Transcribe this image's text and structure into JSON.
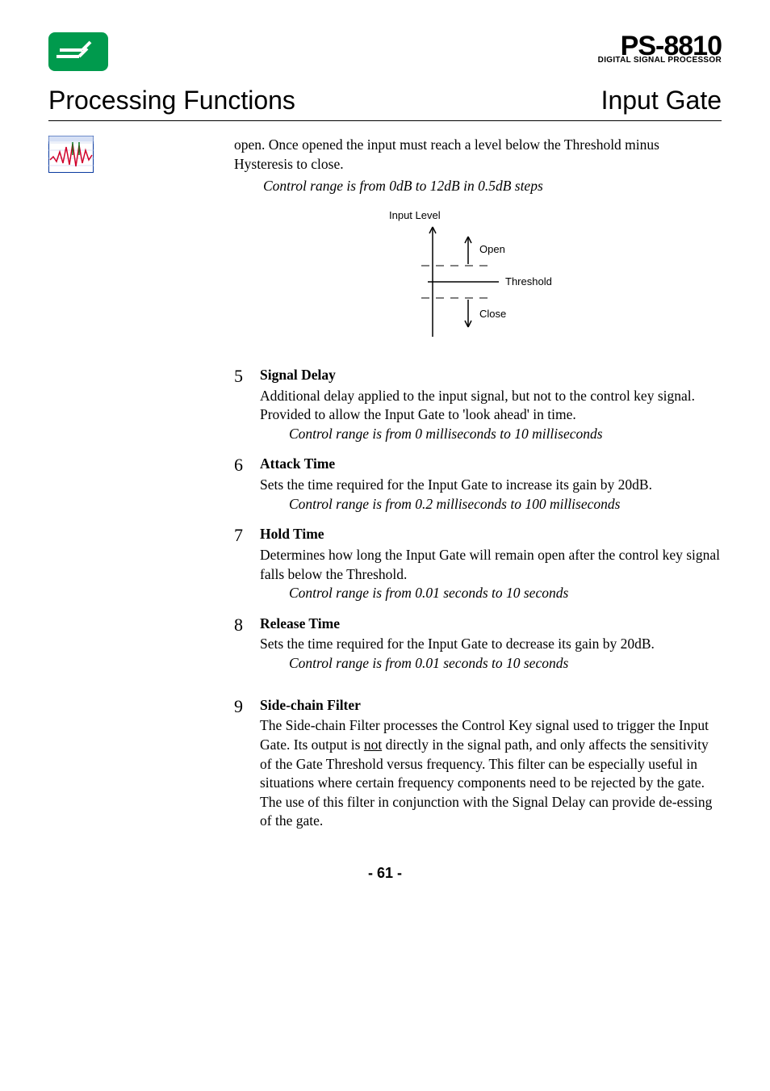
{
  "header": {
    "product_main": "PS-8810",
    "product_sub": "DIGITAL SIGNAL PROCESSOR"
  },
  "title": {
    "left": "Processing Functions",
    "right": "Input Gate"
  },
  "intro": {
    "line1": "open. Once opened the input must reach a level below the Threshold minus Hysteresis to close.",
    "range": "Control range is from 0dB to 12dB in 0.5dB steps"
  },
  "diagram": {
    "caption": "Input Level",
    "label_open": "Open",
    "label_threshold": "Threshold",
    "label_close": "Close"
  },
  "items": [
    {
      "num": "5",
      "title": "Signal Delay",
      "desc": "Additional delay applied to the input signal, but not to the control key signal. Provided to allow the Input Gate to 'look ahead' in time.",
      "range": "Control range is from 0 milliseconds to 10 milliseconds"
    },
    {
      "num": "6",
      "title": "Attack Time",
      "desc": "Sets the time required for the Input Gate to increase its gain by 20dB.",
      "range": "Control range is from 0.2 milliseconds to 100 milliseconds"
    },
    {
      "num": "7",
      "title": "Hold Time",
      "desc": "Determines how long the Input Gate will remain open after the control key signal falls below the Threshold.",
      "range": "Control range is from 0.01 seconds to 10 seconds"
    },
    {
      "num": "8",
      "title": "Release Time",
      "desc": "Sets the time required for the Input Gate to decrease its gain by 20dB.",
      "range": "Control range is from 0.01 seconds to 10 seconds"
    },
    {
      "num": "9",
      "title": "Side-chain Filter",
      "desc_pre": "The Side-chain Filter processes the Control Key signal used to trigger the Input Gate. Its output is ",
      "desc_underline": "not",
      "desc_post": " directly in the signal path, and only affects the sensitivity of the Gate Threshold versus frequency.  This filter can be especially useful in situations where certain frequency components need to be rejected by the gate.  The use of this filter in conjunction with the Signal Delay can provide de-essing of the gate.",
      "range": ""
    }
  ],
  "footer": {
    "page": "- 61 -"
  }
}
